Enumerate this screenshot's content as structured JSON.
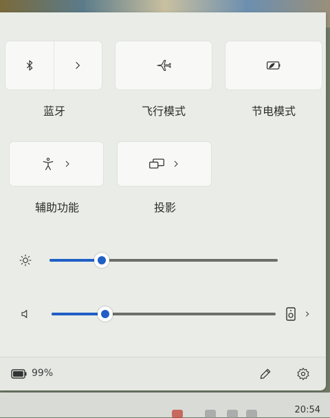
{
  "quick_settings": {
    "tiles": [
      {
        "key": "bluetooth",
        "label": "蓝牙"
      },
      {
        "key": "airplane",
        "label": "飞行模式"
      },
      {
        "key": "battery_saver",
        "label": "节电模式"
      },
      {
        "key": "accessibility",
        "label": "辅助功能"
      },
      {
        "key": "project",
        "label": "投影"
      }
    ]
  },
  "sliders": {
    "brightness": {
      "value": 0.23,
      "icon": "sun-icon"
    },
    "volume": {
      "value": 0.24,
      "icon": "speaker-icon"
    }
  },
  "footer": {
    "battery_text": "99%",
    "battery_value": 0.99
  },
  "taskbar": {
    "time": "20:54"
  },
  "colors": {
    "accent": "#1f5fc6",
    "panel_bg": "#e9ece7",
    "tile_bg": "#f8f9f7"
  }
}
